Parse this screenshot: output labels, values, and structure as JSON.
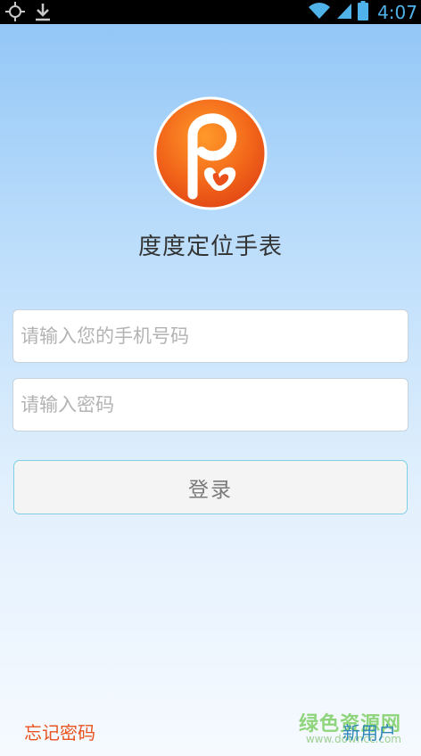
{
  "status_bar": {
    "time": "4:07",
    "icons": [
      "crosshair-icon",
      "download-icon",
      "wifi-icon",
      "signal-icon",
      "battery-icon"
    ]
  },
  "app": {
    "title": "度度定位手表"
  },
  "form": {
    "phone_placeholder": "请输入您的手机号码",
    "password_placeholder": "请输入密码",
    "login_label": "登录"
  },
  "footer": {
    "forgot_label": "忘记密码",
    "new_user_label": "新用户"
  },
  "watermark": {
    "main": "绿色资源网",
    "sub": "www.downcc.com"
  },
  "colors": {
    "accent": "#4fb3ea",
    "logo_orange": "#f06a1a",
    "forgot": "#e8531f",
    "new_user": "#2e87b5"
  }
}
